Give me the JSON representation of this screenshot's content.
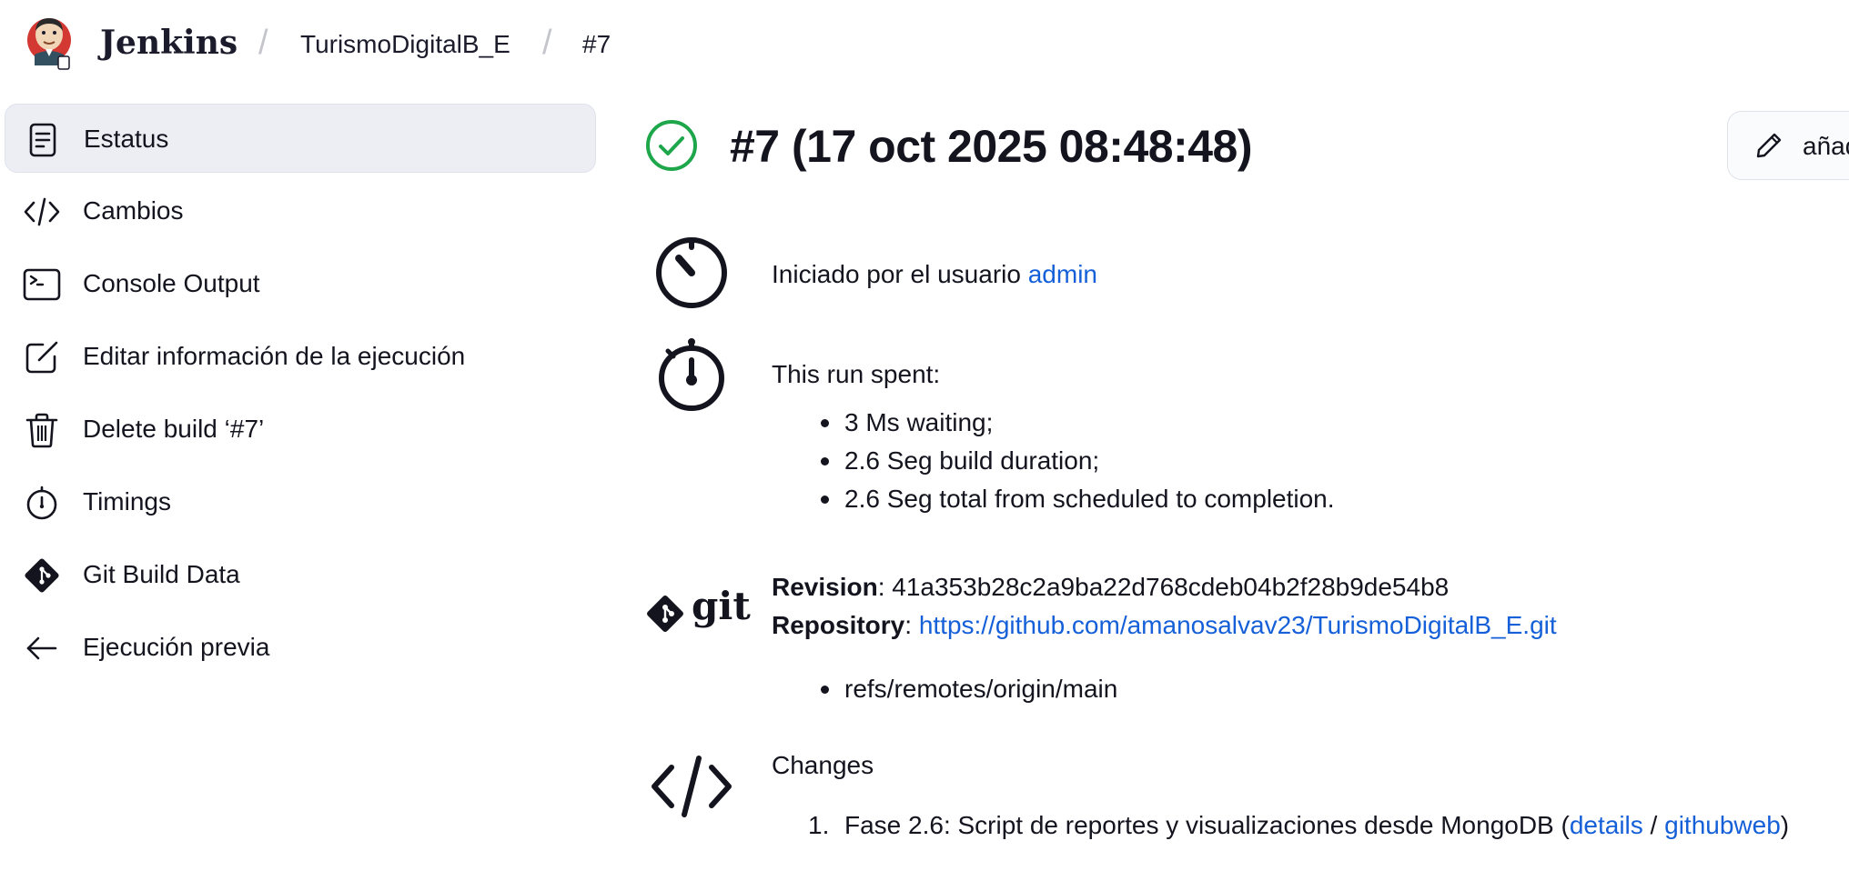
{
  "header": {
    "brand": "Jenkins",
    "breadcrumbs": [
      "TurismoDigitalB_E",
      "#7"
    ]
  },
  "sidebar": {
    "items": [
      {
        "label": "Estatus",
        "icon": "document-icon",
        "active": true
      },
      {
        "label": "Cambios",
        "icon": "code-icon"
      },
      {
        "label": "Console Output",
        "icon": "terminal-icon"
      },
      {
        "label": "Editar información de la ejecución",
        "icon": "edit-icon"
      },
      {
        "label": "Delete build ‘#7’",
        "icon": "trash-icon"
      },
      {
        "label": "Timings",
        "icon": "stopwatch-icon"
      },
      {
        "label": "Git Build Data",
        "icon": "git-icon"
      },
      {
        "label": "Ejecución previa",
        "icon": "arrow-left-icon"
      }
    ]
  },
  "main": {
    "title": "#7 (17 oct 2025 08:48:48)",
    "status": "success",
    "add_button_label": "añadir descripción",
    "started_by": {
      "prefix": "Iniciado por el usuario",
      "user": "admin"
    },
    "run_spent": {
      "heading": "This run spent:",
      "items": [
        "3 Ms waiting;",
        "2.6 Seg build duration;",
        "2.6 Seg total from scheduled to completion."
      ]
    },
    "git": {
      "logo_text": "git",
      "revision_label": "Revision",
      "revision": "41a353b28c2a9ba22d768cdeb04b2f28b9de54b8",
      "repository_label": "Repository",
      "repository": "https://github.com/amanosalvav23/TurismoDigitalB_E.git",
      "refs": [
        "refs/remotes/origin/main"
      ]
    },
    "changes": {
      "heading": "Changes",
      "items": [
        {
          "number": "1.",
          "text": "Fase 2.6: Script de reportes y visualizaciones desde MongoDB (",
          "details": "details",
          "separator": " / ",
          "githubweb": "githubweb",
          "close": ")"
        }
      ]
    }
  },
  "colors": {
    "success": "#1ea64b",
    "link": "#1560d8",
    "active_bg": "#eceef4"
  }
}
